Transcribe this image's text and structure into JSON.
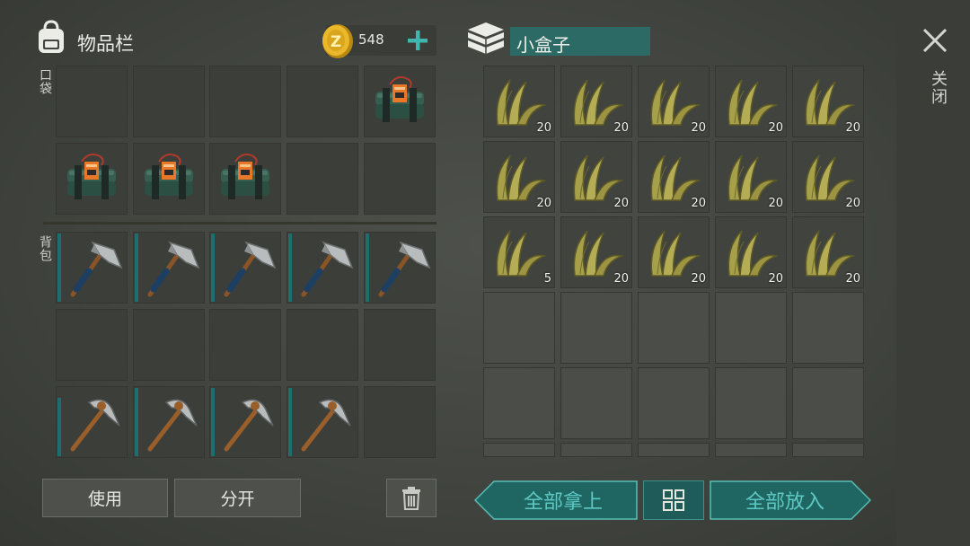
{
  "inventory": {
    "title": "物品栏",
    "coins": "548"
  },
  "labels": {
    "pocket": "口袋",
    "backpack": "背包",
    "close": "关闭"
  },
  "container": {
    "name": "小盒子"
  },
  "buttons": {
    "use": "使用",
    "split": "分开",
    "take_all": "全部拿上",
    "put_all": "全部放入"
  },
  "pocket_slots": [
    {
      "item": "",
      "count": ""
    },
    {
      "item": "",
      "count": ""
    },
    {
      "item": "",
      "count": ""
    },
    {
      "item": "",
      "count": ""
    },
    {
      "item": "explosive-pack",
      "count": ""
    },
    {
      "item": "explosive-pack",
      "count": ""
    },
    {
      "item": "explosive-pack",
      "count": ""
    },
    {
      "item": "explosive-pack",
      "count": ""
    },
    {
      "item": "",
      "count": ""
    },
    {
      "item": "",
      "count": ""
    }
  ],
  "backpack_slots": [
    {
      "item": "hatchet",
      "durability": 1.0
    },
    {
      "item": "hatchet",
      "durability": 1.0
    },
    {
      "item": "hatchet",
      "durability": 1.0
    },
    {
      "item": "hatchet",
      "durability": 1.0
    },
    {
      "item": "hatchet",
      "durability": 1.0
    },
    {
      "item": "",
      "durability": null
    },
    {
      "item": "",
      "durability": null
    },
    {
      "item": "",
      "durability": null
    },
    {
      "item": "",
      "durability": null
    },
    {
      "item": "",
      "durability": null
    },
    {
      "item": "pickaxe",
      "durability": 0.85
    },
    {
      "item": "pickaxe",
      "durability": 1.0
    },
    {
      "item": "pickaxe",
      "durability": 1.0
    },
    {
      "item": "pickaxe",
      "durability": 1.0
    },
    {
      "item": "",
      "durability": null
    }
  ],
  "box_slots": [
    {
      "item": "plant-fiber",
      "count": "20"
    },
    {
      "item": "plant-fiber",
      "count": "20"
    },
    {
      "item": "plant-fiber",
      "count": "20"
    },
    {
      "item": "plant-fiber",
      "count": "20"
    },
    {
      "item": "plant-fiber",
      "count": "20"
    },
    {
      "item": "plant-fiber",
      "count": "20"
    },
    {
      "item": "plant-fiber",
      "count": "20"
    },
    {
      "item": "plant-fiber",
      "count": "20"
    },
    {
      "item": "plant-fiber",
      "count": "20"
    },
    {
      "item": "plant-fiber",
      "count": "20"
    },
    {
      "item": "plant-fiber",
      "count": "5"
    },
    {
      "item": "plant-fiber",
      "count": "20"
    },
    {
      "item": "plant-fiber",
      "count": "20"
    },
    {
      "item": "plant-fiber",
      "count": "20"
    },
    {
      "item": "plant-fiber",
      "count": "20"
    },
    {
      "item": "",
      "count": ""
    },
    {
      "item": "",
      "count": ""
    },
    {
      "item": "",
      "count": ""
    },
    {
      "item": "",
      "count": ""
    },
    {
      "item": "",
      "count": ""
    },
    {
      "item": "",
      "count": ""
    },
    {
      "item": "",
      "count": ""
    },
    {
      "item": "",
      "count": ""
    },
    {
      "item": "",
      "count": ""
    },
    {
      "item": "",
      "count": ""
    },
    {
      "item": "",
      "count": ""
    },
    {
      "item": "",
      "count": ""
    },
    {
      "item": "",
      "count": ""
    },
    {
      "item": "",
      "count": ""
    },
    {
      "item": "",
      "count": ""
    }
  ],
  "icons": {
    "backpack": "backpack-icon",
    "coin": "coin-icon",
    "add": "plus-icon",
    "box": "box-icon",
    "close": "close-icon",
    "trash": "trash-icon",
    "sort": "sort-grid-icon"
  },
  "colors": {
    "accent": "#5ec8c2",
    "teal_button": "#1f6663",
    "coin": "#e9b828",
    "durability": "#1e6e70",
    "count_text": "#f2f2ee"
  }
}
